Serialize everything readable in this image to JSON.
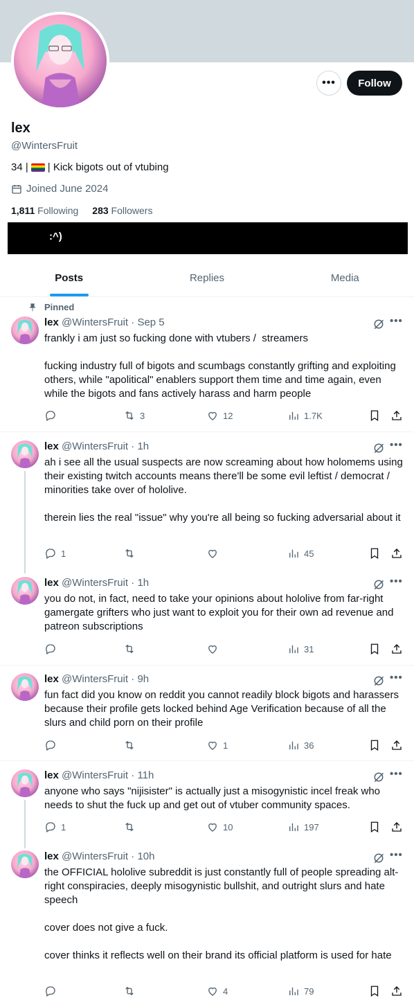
{
  "profile": {
    "name": "lex",
    "handle": "@WintersFruit",
    "bio_prefix": "34 |",
    "bio_suffix": "| Kick bigots out of vtubing",
    "joined": "Joined June 2024",
    "following_count": "1,811",
    "following_label": "Following",
    "followers_count": "283",
    "followers_label": "Followers",
    "follow_label": "Follow",
    "more_label": "•••",
    "strip_text": ":^)"
  },
  "tabs": [
    {
      "label": "Posts"
    },
    {
      "label": "Replies"
    },
    {
      "label": "Media"
    }
  ],
  "pinned_label": "Pinned",
  "posts": [
    {
      "name": "lex",
      "handle": "@WintersFruit",
      "time": "· Sep 5",
      "text": "frankly i am just so fucking done with vtubers /  streamers\n\nfucking industry full of bigots and scumbags constantly grifting and exploiting others, while \"apolitical\" enablers support them time and time again, even while the bigots and fans actively harass and harm people",
      "replies": "",
      "reposts": "3",
      "likes": "12",
      "views": "1.7K"
    },
    {
      "name": "lex",
      "handle": "@WintersFruit",
      "time": "· 1h",
      "text": "ah i see all the usual suspects are now screaming about how holomems using their existing twitch accounts means there'll be some evil leftist / democrat / minorities take over of hololive.\n\ntherein lies the real \"issue\" why you're all being so fucking adversarial about it",
      "replies": "1",
      "reposts": "",
      "likes": "",
      "views": "45"
    },
    {
      "name": "lex",
      "handle": "@WintersFruit",
      "time": "· 1h",
      "text": "you do not, in fact, need to take your opinions about hololive from far-right gamergate grifters who just want to exploit you for their own ad revenue and patreon subscriptions",
      "replies": "",
      "reposts": "",
      "likes": "",
      "views": "31"
    },
    {
      "name": "lex",
      "handle": "@WintersFruit",
      "time": "· 9h",
      "text": "fun fact did you know on reddit you cannot readily block bigots and harassers because their profile gets locked behind Age Verification because of all the slurs and child porn on their profile",
      "replies": "",
      "reposts": "",
      "likes": "1",
      "views": "36"
    },
    {
      "name": "lex",
      "handle": "@WintersFruit",
      "time": "· 11h",
      "text": "anyone who says \"nijisister\" is actually just a misogynistic incel freak who needs to shut the fuck up and get out of vtuber community spaces.",
      "replies": "1",
      "reposts": "",
      "likes": "10",
      "views": "197"
    },
    {
      "name": "lex",
      "handle": "@WintersFruit",
      "time": "· 10h",
      "text": "the OFFICIAL hololive subreddit is just constantly full of people spreading alt-right conspiracies, deeply misogynistic bullshit, and outright slurs and hate speech\n\ncover does not give a fuck.\n\ncover thinks it reflects well on their brand its official platform is used for hate",
      "replies": "",
      "reposts": "",
      "likes": "4",
      "views": "79"
    }
  ],
  "colors": {
    "banner": "#cfd9de",
    "accent": "#1d9bf0",
    "text": "#0f1419",
    "muted": "#536471"
  },
  "icons": [
    "pin-icon",
    "grok-icon",
    "more-icon",
    "reply-icon",
    "repost-icon",
    "like-icon",
    "views-icon",
    "bookmark-icon",
    "share-icon",
    "calendar-icon"
  ]
}
